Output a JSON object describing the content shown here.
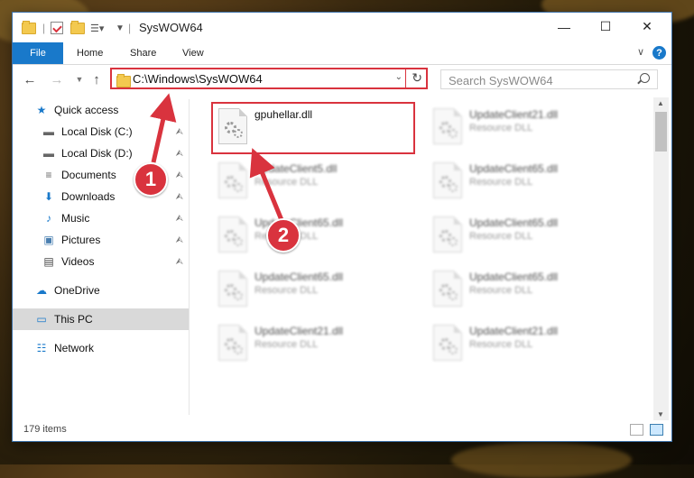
{
  "window": {
    "title": "SysWOW64",
    "controls": {
      "minimize": "—",
      "maximize": "☐",
      "close": "✕"
    }
  },
  "ribbon": {
    "tabs": [
      {
        "label": "File"
      },
      {
        "label": "Home"
      },
      {
        "label": "Share"
      },
      {
        "label": "View"
      }
    ],
    "help": "?",
    "expand": "∨"
  },
  "navbar": {
    "address": "C:\\Windows\\SysWOW64",
    "search_placeholder": "Search SysWOW64"
  },
  "sidebar": {
    "items": [
      {
        "label": "Quick access",
        "icon": "star-icon",
        "glyph": "★",
        "color": "#1979ca",
        "pinned": false
      },
      {
        "label": "Local Disk (C:)",
        "icon": "drive-icon",
        "glyph": "▬",
        "color": "#666666",
        "pinned": true
      },
      {
        "label": "Local Disk (D:)",
        "icon": "drive-icon",
        "glyph": "▬",
        "color": "#666666",
        "pinned": true
      },
      {
        "label": "Documents",
        "icon": "documents-icon",
        "glyph": "≡",
        "color": "#666666",
        "pinned": true
      },
      {
        "label": "Downloads",
        "icon": "download-icon",
        "glyph": "⬇",
        "color": "#1979ca",
        "pinned": true
      },
      {
        "label": "Music",
        "icon": "music-icon",
        "glyph": "♪",
        "color": "#1979ca",
        "pinned": true
      },
      {
        "label": "Pictures",
        "icon": "pictures-icon",
        "glyph": "▣",
        "color": "#4a7fb0",
        "pinned": true
      },
      {
        "label": "Videos",
        "icon": "videos-icon",
        "glyph": "▤",
        "color": "#444444",
        "pinned": true
      },
      {
        "label": "OneDrive",
        "icon": "cloud-icon",
        "glyph": "☁",
        "color": "#1979ca",
        "pinned": false
      },
      {
        "label": "This PC",
        "icon": "computer-icon",
        "glyph": "▭",
        "color": "#1979ca",
        "pinned": false
      },
      {
        "label": "Network",
        "icon": "network-icon",
        "glyph": "☷",
        "color": "#1979ca",
        "pinned": false
      }
    ]
  },
  "files": [
    {
      "name": "gpuhellar.dll",
      "type": "",
      "blurred": false
    },
    {
      "name": "UpdateClient21.dll",
      "type": "Resource DLL",
      "blurred": true
    },
    {
      "name": "UpdateClient5.dll",
      "type": "Resource DLL",
      "blurred": true
    },
    {
      "name": "UpdateClient65.dll",
      "type": "Resource DLL",
      "blurred": true
    },
    {
      "name": "UpdateClient65.dll",
      "type": "Resource DLL",
      "blurred": true
    },
    {
      "name": "UpdateClient65.dll",
      "type": "Resource DLL",
      "blurred": true
    },
    {
      "name": "UpdateClient65.dll",
      "type": "Resource DLL",
      "blurred": true
    },
    {
      "name": "UpdateClient65.dll",
      "type": "Resource DLL",
      "blurred": true
    },
    {
      "name": "UpdateClient21.dll",
      "type": "Resource DLL",
      "blurred": true
    },
    {
      "name": "UpdateClient21.dll",
      "type": "Resource DLL",
      "blurred": true
    }
  ],
  "status": {
    "item_count": "179 items"
  },
  "annotations": {
    "step1": "1",
    "step2": "2",
    "color": "#d9333e"
  }
}
